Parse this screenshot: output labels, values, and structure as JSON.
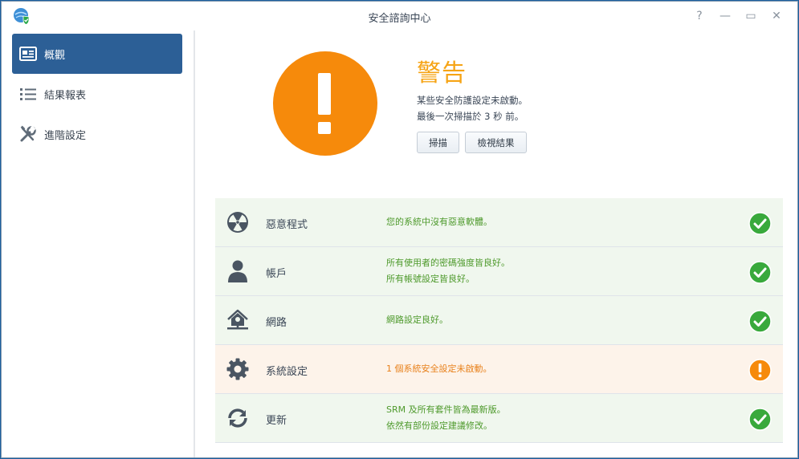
{
  "window": {
    "title": "安全諮詢中心",
    "controls": {
      "help": "?",
      "minimize": "—",
      "maximize": "▭",
      "close": "✕"
    }
  },
  "sidebar": {
    "items": [
      {
        "label": "概觀",
        "icon": "overview-icon",
        "active": true
      },
      {
        "label": "結果報表",
        "icon": "list-icon",
        "active": false
      },
      {
        "label": "進階設定",
        "icon": "tools-icon",
        "active": false
      }
    ]
  },
  "summary": {
    "headline": "警告",
    "line1": "某些安全防護設定未啟動。",
    "line2": "最後一次掃描於 3 秒 前。",
    "scan_button": "掃描",
    "view_results_button": "檢視結果"
  },
  "categories": [
    {
      "name": "惡意程式",
      "icon": "radiation-icon",
      "status": "ok",
      "messages": [
        "您的系統中沒有惡意軟體。"
      ]
    },
    {
      "name": "帳戶",
      "icon": "user-icon",
      "status": "ok",
      "messages": [
        "所有使用者的密碼強度皆良好。",
        "所有帳號設定皆良好。"
      ]
    },
    {
      "name": "網路",
      "icon": "network-home-icon",
      "status": "ok",
      "messages": [
        "網路設定良好。"
      ]
    },
    {
      "name": "系統設定",
      "icon": "gear-icon",
      "status": "warning",
      "messages": [
        "1 個系統安全設定未啟動。"
      ]
    },
    {
      "name": "更新",
      "icon": "refresh-icon",
      "status": "ok",
      "messages": [
        "SRM 及所有套件皆為最新版。",
        "依然有部份設定建議修改。"
      ]
    }
  ],
  "colors": {
    "ok": "#39a93c",
    "warning": "#f68a0b",
    "headline": "#f6a415",
    "sidebar_active": "#2c5f96"
  }
}
